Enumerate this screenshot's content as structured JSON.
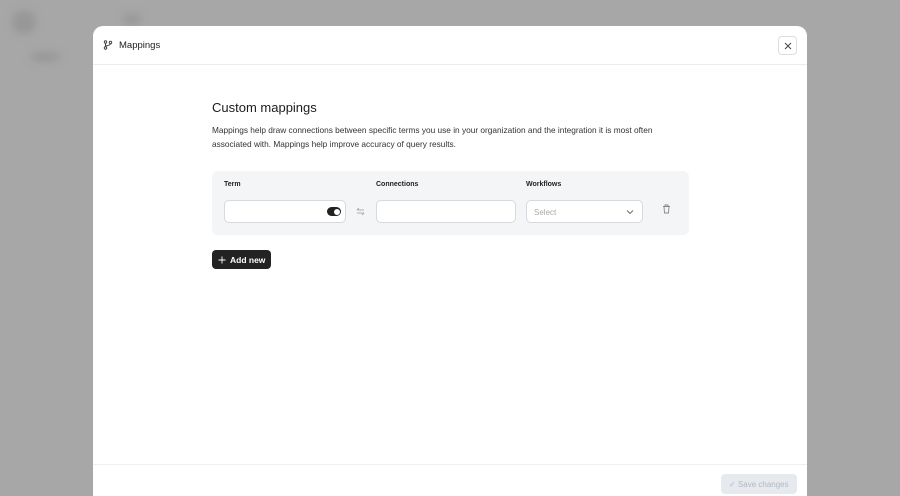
{
  "modal": {
    "title": "Mappings",
    "heading": "Custom mappings",
    "description": "Mappings help draw connections between specific terms you use in your organization and the integration it is most often associated with. Mappings help improve accuracy of query results.",
    "columns": {
      "term": "Term",
      "connections": "Connections",
      "workflows": "Workflows"
    },
    "row": {
      "term_value": "",
      "connections_value": "",
      "workflows_placeholder": "Select",
      "toggle_on": true
    },
    "add_label": "Add new",
    "save_label": "✓ Save changes"
  }
}
